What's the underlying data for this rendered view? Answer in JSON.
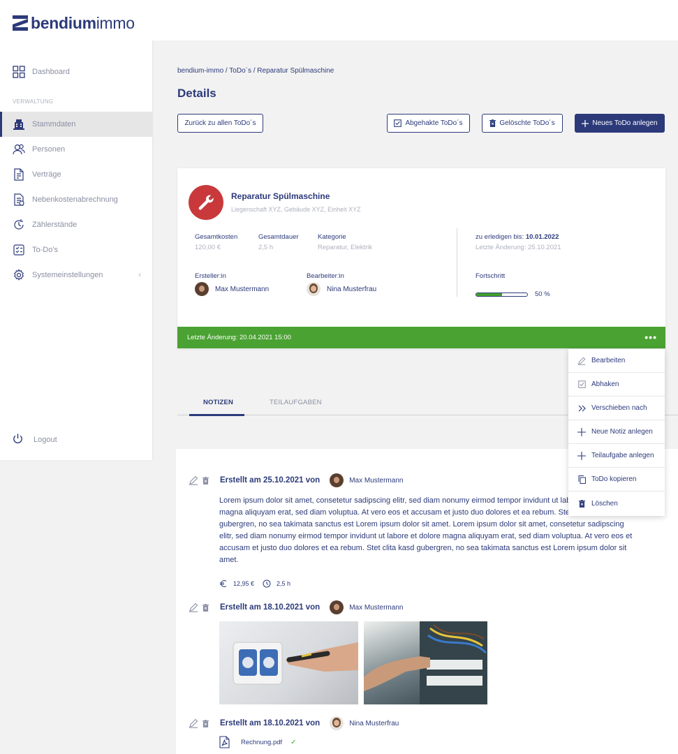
{
  "brand": {
    "bold": "bendium",
    "light": "immo",
    "color": "#2c3a7a"
  },
  "colors": {
    "primary": "#2c3a7a",
    "success": "#4aa232",
    "danger": "#c9393b",
    "muted": "#8b8fa3"
  },
  "sidebar": {
    "dashboard": {
      "label": "Dashboard",
      "icon": "dashboard-icon"
    },
    "section_label": "VERWALTUNG",
    "items": [
      {
        "label": "Stammdaten",
        "icon": "building-icon",
        "active": true
      },
      {
        "label": "Personen",
        "icon": "people-icon"
      },
      {
        "label": "Verträge",
        "icon": "contract-icon"
      },
      {
        "label": "Nebenkostenabrechnung",
        "icon": "billing-icon"
      },
      {
        "label": "Zählerstände",
        "icon": "meter-icon"
      },
      {
        "label": "To-Do's",
        "icon": "todo-icon"
      },
      {
        "label": "Systemeinstellungen",
        "icon": "gear-icon"
      }
    ],
    "collapse_glyph": "‹",
    "logout": "Logout"
  },
  "breadcrumb": "bendium-immo / ToDo´s / Reparatur Spülmaschine",
  "page_title": "Details",
  "buttons": {
    "back": "Zurück zu allen ToDo´s",
    "checked": "Abgehakte ToDo´s",
    "deleted": "Gelöschte ToDo´s",
    "new": "Neues ToDo anlegen"
  },
  "todo": {
    "title": "Reparatur Spülmaschine",
    "subtitle": "Liegenschaft XYZ, Gebäude XYZ, Einheit XYZ",
    "total_cost_label": "Gesamtkosten",
    "total_cost": "120,00 €",
    "duration_label": "Gesamtdauer",
    "duration": "2,5 h",
    "category_label": "Kategorie",
    "category": "Reparatur, Elektrik",
    "due_prefix": "zu erledigen bis: ",
    "due_date": "10.01.2022",
    "last_change": "Letzte Änderung: 25.10.2021",
    "creator_label": "Ersteller:in",
    "creator": "Max Mustermann",
    "editor_label": "Bearbeiter:in",
    "editor": "Nina Musterfrau",
    "progress_label": "Fortschritt",
    "progress_value": 50,
    "progress_text": "50 %",
    "footer": "Letzte Änderung: 20.04.2021 15:00",
    "more_glyph": "•••"
  },
  "tabs": [
    {
      "label": "NOTIZEN",
      "active": true
    },
    {
      "label": "TEILAUFGABEN",
      "active": false
    }
  ],
  "notes": [
    {
      "title": "Erstellt am 25.10.2021 von",
      "author": "Max Mustermann",
      "body": "Lorem ipsum dolor sit amet, consetetur sadipscing elitr, sed diam nonumy eirmod tempor invidunt ut labore et dolore magna aliquyam erat, sed diam voluptua. At vero eos et accusam et justo duo dolores et ea rebum. Stet clita kasd gubergren, no sea takimata sanctus est Lorem ipsum dolor sit amet. Lorem ipsum dolor sit amet, consetetur sadipscing elitr, sed diam nonumy eirmod tempor invidunt ut labore et dolore magna aliquyam erat, sed diam voluptua. At vero eos et accusam et justo duo dolores et ea rebum. Stet clita kasd gubergren, no sea takimata sanctus est Lorem ipsum dolor sit amet.",
      "cost": "12,95 €",
      "time": "2,5 h"
    },
    {
      "title": "Erstellt am 18.10.2021 von",
      "author": "Max Mustermann"
    },
    {
      "title": "Erstellt am 18.10.2021 von",
      "author": "Nina Musterfrau",
      "file": "Rechnung.pdf",
      "file_status": "✓"
    }
  ],
  "menu": [
    {
      "label": "Bearbeiten",
      "icon": "pencil-icon"
    },
    {
      "label": "Abhaken",
      "icon": "checkbox-icon"
    },
    {
      "label": "Verschieben nach",
      "icon": "double-chevron-icon"
    },
    {
      "label": "Neue Notiz anlegen",
      "icon": "plus-icon"
    },
    {
      "label": "Teilaufgabe anlegen",
      "icon": "plus-icon"
    },
    {
      "label": "ToDo kopieren",
      "icon": "copy-icon"
    },
    {
      "label": "Löschen",
      "icon": "trash-icon"
    }
  ]
}
